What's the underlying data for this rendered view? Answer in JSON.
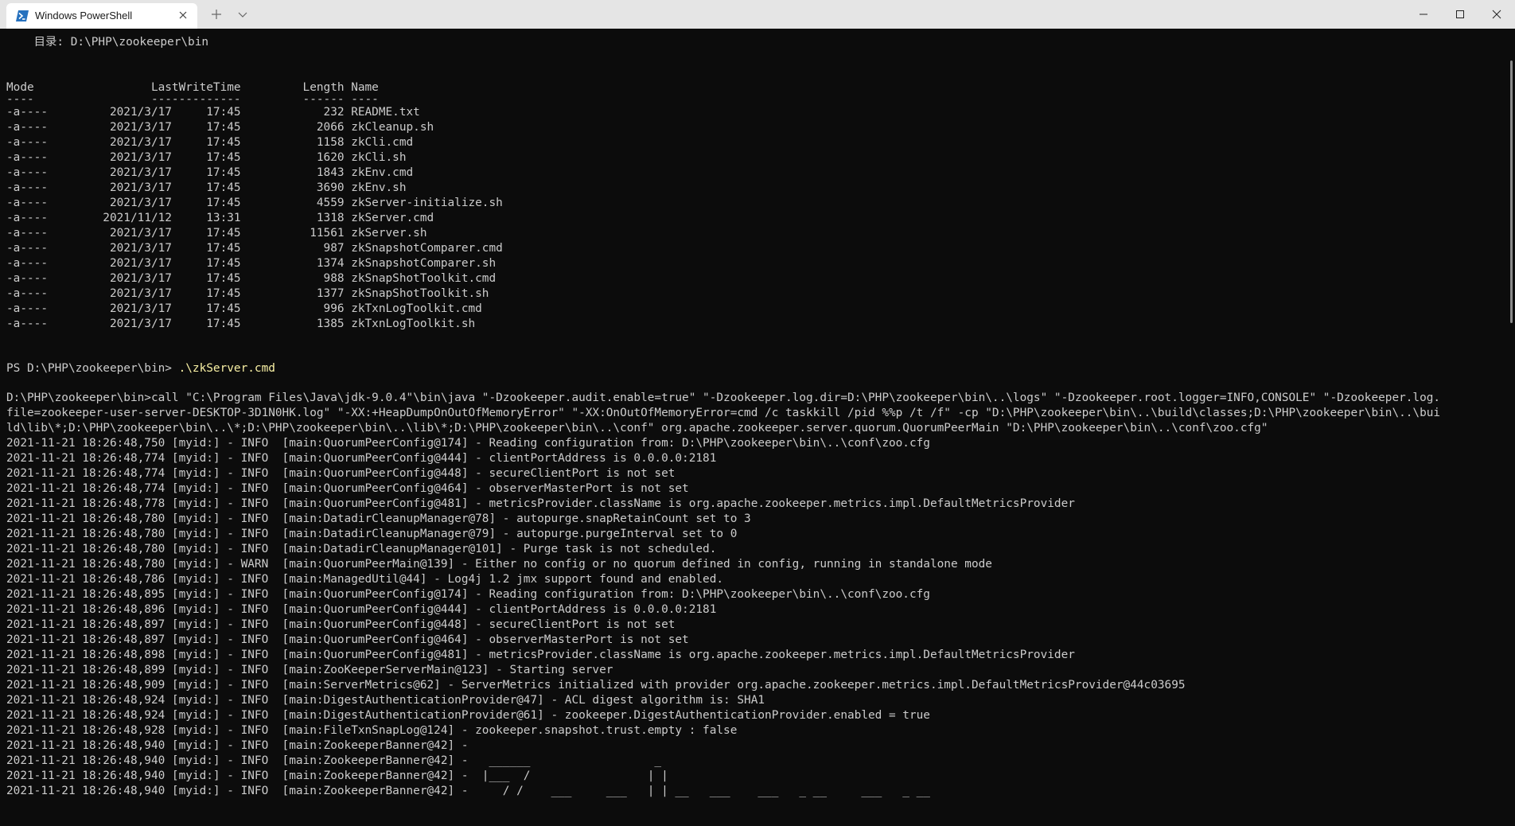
{
  "window": {
    "tab_title": "Windows PowerShell",
    "tab_icon": "powershell-icon",
    "close_tab_icon": "close-icon",
    "new_tab_icon": "plus-icon",
    "dropdown_icon": "chevron-down-icon",
    "controls": [
      "minimize-icon",
      "maximize-icon",
      "close-icon"
    ]
  },
  "colors": {
    "background": "#0c0c0c",
    "text": "#cccccc",
    "command": "#f9f1a5",
    "titlebar": "#e5e5e5"
  },
  "terminal": {
    "directory_header": "    目录: D:\\PHP\\zookeeper\\bin",
    "listing_columns": "Mode                 LastWriteTime         Length Name",
    "listing_underline": "----                 -------------         ------ ----",
    "files": [
      "-a----         2021/3/17     17:45            232 README.txt",
      "-a----         2021/3/17     17:45           2066 zkCleanup.sh",
      "-a----         2021/3/17     17:45           1158 zkCli.cmd",
      "-a----         2021/3/17     17:45           1620 zkCli.sh",
      "-a----         2021/3/17     17:45           1843 zkEnv.cmd",
      "-a----         2021/3/17     17:45           3690 zkEnv.sh",
      "-a----         2021/3/17     17:45           4559 zkServer-initialize.sh",
      "-a----        2021/11/12     13:31           1318 zkServer.cmd",
      "-a----         2021/3/17     17:45          11561 zkServer.sh",
      "-a----         2021/3/17     17:45            987 zkSnapshotComparer.cmd",
      "-a----         2021/3/17     17:45           1374 zkSnapshotComparer.sh",
      "-a----         2021/3/17     17:45            988 zkSnapShotToolkit.cmd",
      "-a----         2021/3/17     17:45           1377 zkSnapShotToolkit.sh",
      "-a----         2021/3/17     17:45            996 zkTxnLogToolkit.cmd",
      "-a----         2021/3/17     17:45           1385 zkTxnLogToolkit.sh"
    ],
    "prompt": "PS D:\\PHP\\zookeeper\\bin> ",
    "command": ".\\zkServer.cmd",
    "output": [
      "D:\\PHP\\zookeeper\\bin>call \"C:\\Program Files\\Java\\jdk-9.0.4\"\\bin\\java \"-Dzookeeper.audit.enable=true\" \"-Dzookeeper.log.dir=D:\\PHP\\zookeeper\\bin\\..\\logs\" \"-Dzookeeper.root.logger=INFO,CONSOLE\" \"-Dzookeeper.log.",
      "file=zookeeper-user-server-DESKTOP-3D1N0HK.log\" \"-XX:+HeapDumpOnOutOfMemoryError\" \"-XX:OnOutOfMemoryError=cmd /c taskkill /pid %%p /t /f\" -cp \"D:\\PHP\\zookeeper\\bin\\..\\build\\classes;D:\\PHP\\zookeeper\\bin\\..\\bui",
      "ld\\lib\\*;D:\\PHP\\zookeeper\\bin\\..\\*;D:\\PHP\\zookeeper\\bin\\..\\lib\\*;D:\\PHP\\zookeeper\\bin\\..\\conf\" org.apache.zookeeper.server.quorum.QuorumPeerMain \"D:\\PHP\\zookeeper\\bin\\..\\conf\\zoo.cfg\"",
      "2021-11-21 18:26:48,750 [myid:] - INFO  [main:QuorumPeerConfig@174] - Reading configuration from: D:\\PHP\\zookeeper\\bin\\..\\conf\\zoo.cfg",
      "2021-11-21 18:26:48,774 [myid:] - INFO  [main:QuorumPeerConfig@444] - clientPortAddress is 0.0.0.0:2181",
      "2021-11-21 18:26:48,774 [myid:] - INFO  [main:QuorumPeerConfig@448] - secureClientPort is not set",
      "2021-11-21 18:26:48,774 [myid:] - INFO  [main:QuorumPeerConfig@464] - observerMasterPort is not set",
      "2021-11-21 18:26:48,778 [myid:] - INFO  [main:QuorumPeerConfig@481] - metricsProvider.className is org.apache.zookeeper.metrics.impl.DefaultMetricsProvider",
      "2021-11-21 18:26:48,780 [myid:] - INFO  [main:DatadirCleanupManager@78] - autopurge.snapRetainCount set to 3",
      "2021-11-21 18:26:48,780 [myid:] - INFO  [main:DatadirCleanupManager@79] - autopurge.purgeInterval set to 0",
      "2021-11-21 18:26:48,780 [myid:] - INFO  [main:DatadirCleanupManager@101] - Purge task is not scheduled.",
      "2021-11-21 18:26:48,780 [myid:] - WARN  [main:QuorumPeerMain@139] - Either no config or no quorum defined in config, running in standalone mode",
      "2021-11-21 18:26:48,786 [myid:] - INFO  [main:ManagedUtil@44] - Log4j 1.2 jmx support found and enabled.",
      "2021-11-21 18:26:48,895 [myid:] - INFO  [main:QuorumPeerConfig@174] - Reading configuration from: D:\\PHP\\zookeeper\\bin\\..\\conf\\zoo.cfg",
      "2021-11-21 18:26:48,896 [myid:] - INFO  [main:QuorumPeerConfig@444] - clientPortAddress is 0.0.0.0:2181",
      "2021-11-21 18:26:48,897 [myid:] - INFO  [main:QuorumPeerConfig@448] - secureClientPort is not set",
      "2021-11-21 18:26:48,897 [myid:] - INFO  [main:QuorumPeerConfig@464] - observerMasterPort is not set",
      "2021-11-21 18:26:48,898 [myid:] - INFO  [main:QuorumPeerConfig@481] - metricsProvider.className is org.apache.zookeeper.metrics.impl.DefaultMetricsProvider",
      "2021-11-21 18:26:48,899 [myid:] - INFO  [main:ZooKeeperServerMain@123] - Starting server",
      "2021-11-21 18:26:48,909 [myid:] - INFO  [main:ServerMetrics@62] - ServerMetrics initialized with provider org.apache.zookeeper.metrics.impl.DefaultMetricsProvider@44c03695",
      "2021-11-21 18:26:48,924 [myid:] - INFO  [main:DigestAuthenticationProvider@47] - ACL digest algorithm is: SHA1",
      "2021-11-21 18:26:48,924 [myid:] - INFO  [main:DigestAuthenticationProvider@61] - zookeeper.DigestAuthenticationProvider.enabled = true",
      "2021-11-21 18:26:48,928 [myid:] - INFO  [main:FileTxnSnapLog@124] - zookeeper.snapshot.trust.empty : false",
      "2021-11-21 18:26:48,940 [myid:] - INFO  [main:ZookeeperBanner@42] - ",
      "2021-11-21 18:26:48,940 [myid:] - INFO  [main:ZookeeperBanner@42] -   ______                  _",
      "2021-11-21 18:26:48,940 [myid:] - INFO  [main:ZookeeperBanner@42] -  |___  /                 | |",
      "2021-11-21 18:26:48,940 [myid:] - INFO  [main:ZookeeperBanner@42] -     / /    ___     ___   | | __   ___    ___   _ __     ___   _ __"
    ]
  }
}
